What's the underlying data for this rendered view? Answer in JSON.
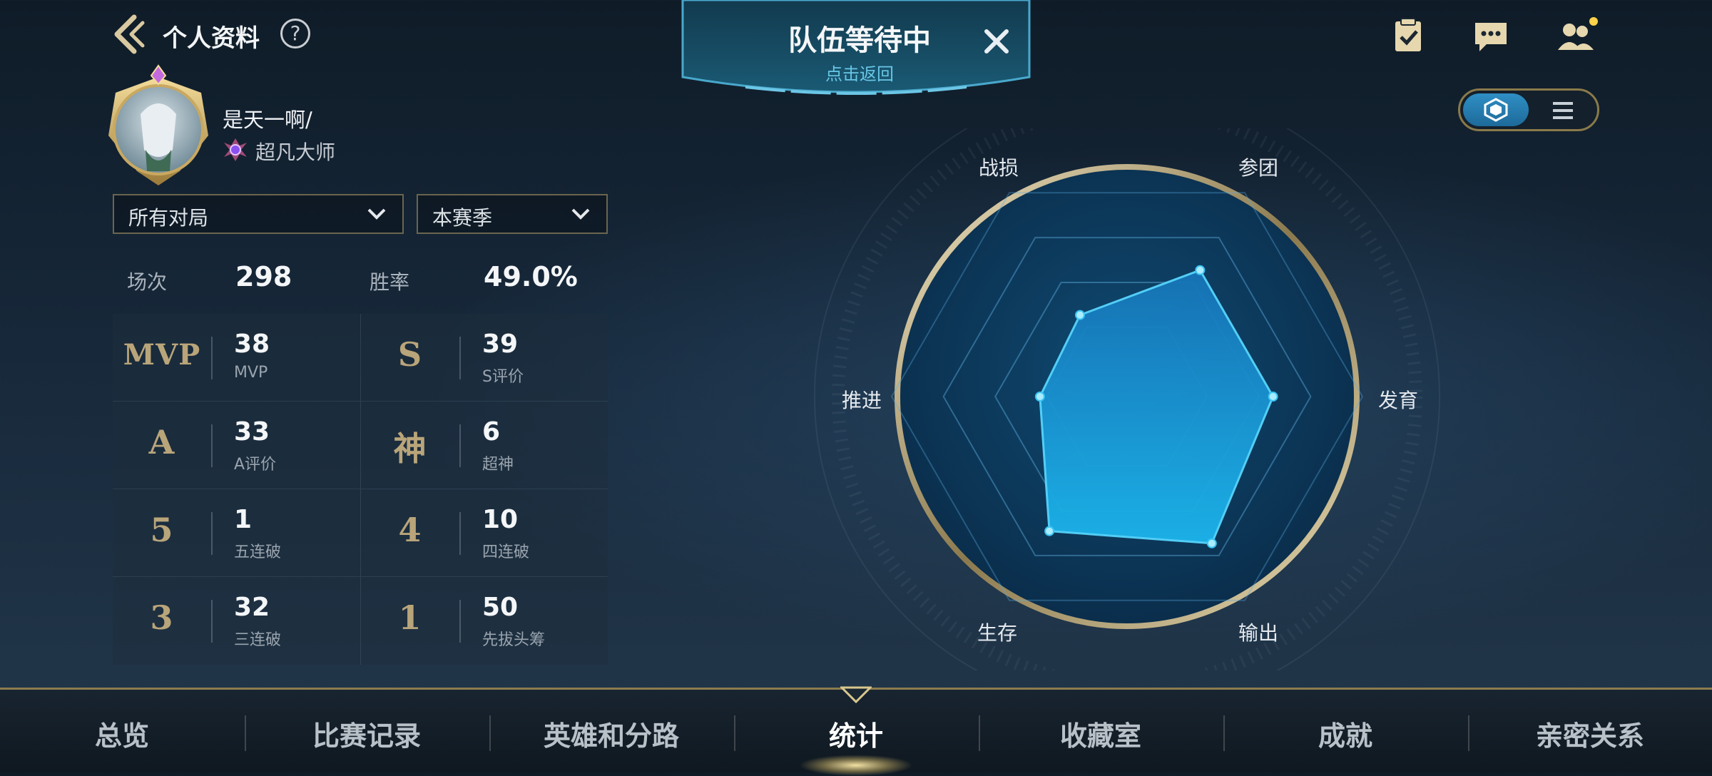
{
  "header": {
    "title": "个人资料",
    "help_symbol": "?"
  },
  "banner": {
    "title": "队伍等待中",
    "subtitle": "点击返回",
    "close_symbol": "✕"
  },
  "top_icons": [
    "task-list-icon",
    "chat-icon",
    "friends-icon"
  ],
  "view_toggle": {
    "selected": "radar-view",
    "options": [
      "radar-view",
      "list-view"
    ]
  },
  "profile": {
    "username": "是天一啊/",
    "rank": "超凡大师"
  },
  "filters": {
    "mode": "所有对局",
    "season": "本赛季"
  },
  "summary": {
    "games_label": "场次",
    "games_value": "298",
    "winrate_label": "胜率",
    "winrate_value": "49.0%"
  },
  "stats": [
    {
      "icon": "MVP",
      "value": "38",
      "label": "MVP"
    },
    {
      "icon": "S",
      "value": "39",
      "label": "S评价"
    },
    {
      "icon": "A",
      "value": "33",
      "label": "A评价"
    },
    {
      "icon": "神",
      "value": "6",
      "label": "超神"
    },
    {
      "icon": "5",
      "value": "1",
      "label": "五连破"
    },
    {
      "icon": "4",
      "value": "10",
      "label": "四连破"
    },
    {
      "icon": "3",
      "value": "32",
      "label": "三连破"
    },
    {
      "icon": "1",
      "value": "50",
      "label": "先拔头筹"
    }
  ],
  "radar": {
    "axes": [
      "参团",
      "发育",
      "输出",
      "生存",
      "推进",
      "战损"
    ],
    "values": [
      0.62,
      0.62,
      0.72,
      0.66,
      0.37,
      0.4
    ],
    "colors": {
      "fill": "#1aa6e0",
      "stroke": "#5ad8ff"
    }
  },
  "nav": {
    "items": [
      "总览",
      "比赛记录",
      "英雄和分路",
      "统计",
      "收藏室",
      "成就",
      "亲密关系"
    ],
    "active_index": 3
  }
}
